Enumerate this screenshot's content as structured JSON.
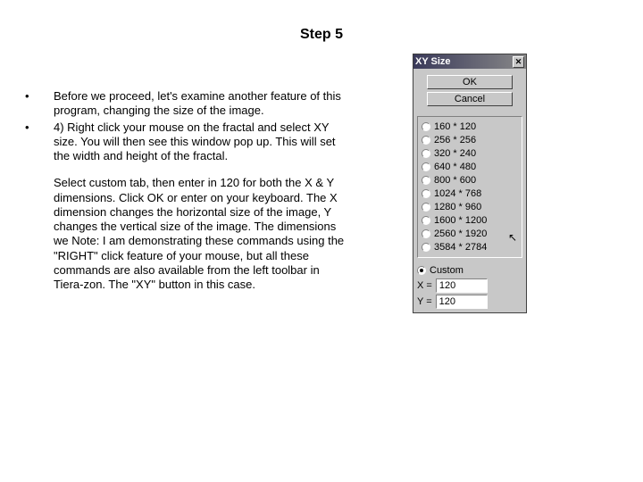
{
  "title": "Step 5",
  "bullets": [
    "Before we proceed, let's examine another feature of this program, changing the size of the image.",
    "4) Right click your mouse on the fractal and select XY size. You will then see this window pop up. This will set the width and height of the fractal."
  ],
  "continuation": "Select custom tab, then enter in 120 for both the X & Y dimensions. Click OK or enter on your keyboard. The X dimension changes the horizontal size of the image, Y changes the vertical size of the image. The dimensions we Note: I am demonstrating these commands using the \"RIGHT\" click feature of your mouse, but all these commands are also available from the left toolbar in Tiera-zon. The \"XY\" button in this case.",
  "dialog": {
    "title": "XY Size",
    "ok": "OK",
    "cancel": "Cancel",
    "presets": [
      "160 * 120",
      "256 * 256",
      "320 * 240",
      "640 * 480",
      "800 * 600",
      "1024 * 768",
      "1280 * 960",
      "1600 * 1200",
      "2560 * 1920",
      "3584 * 2784"
    ],
    "custom_label": "Custom",
    "x_label": "X =",
    "y_label": "Y =",
    "x_value": "120",
    "y_value": "120"
  }
}
